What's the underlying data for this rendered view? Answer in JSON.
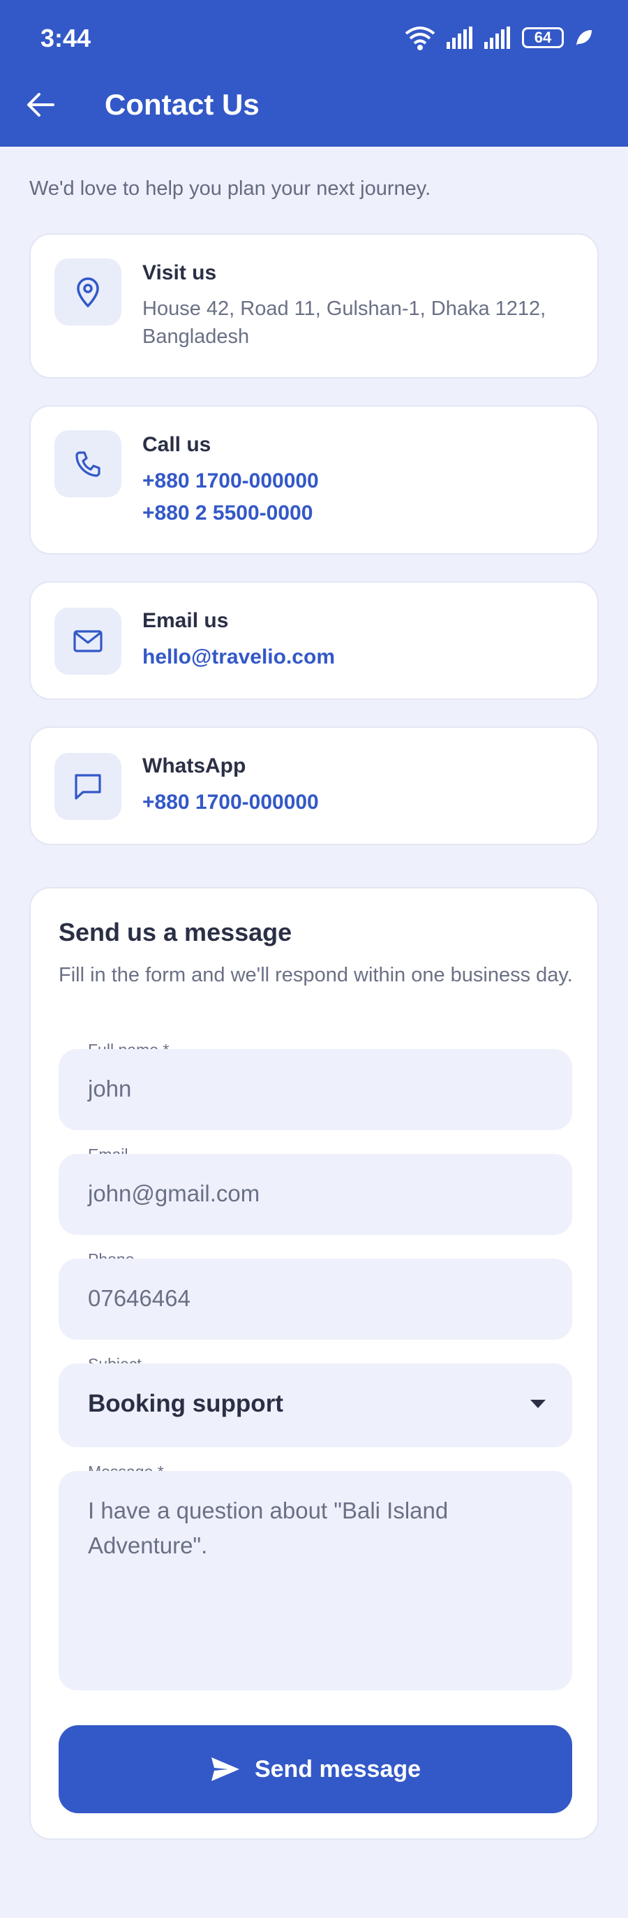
{
  "status_bar": {
    "time": "3:44",
    "battery": "64"
  },
  "app_bar": {
    "title": "Contact Us"
  },
  "intro": "We'd love to help you plan your next journey.",
  "cards": {
    "visit": {
      "title": "Visit us",
      "address": "House 42, Road 11, Gulshan-1, Dhaka 1212, Bangladesh",
      "icon": "location-pin-icon"
    },
    "call": {
      "title": "Call us",
      "phone1": "+880 1700-000000",
      "phone2": "+880 2 5500-0000",
      "icon": "phone-icon"
    },
    "email": {
      "title": "Email us",
      "address": "hello@travelio.com",
      "icon": "mail-icon"
    },
    "whatsapp": {
      "title": "WhatsApp",
      "phone": "+880 1700-000000",
      "icon": "chat-icon"
    }
  },
  "form": {
    "title": "Send us a message",
    "subtitle": "Fill in the form and we'll respond within one business day.",
    "full_name": {
      "label": "Full name *",
      "value": "john"
    },
    "email": {
      "label": "Email",
      "value": "john@gmail.com"
    },
    "phone": {
      "label": "Phone",
      "value": "07646464"
    },
    "subject": {
      "label": "Subject",
      "value": "Booking support"
    },
    "message": {
      "label": "Message *",
      "value": "I have a question about \"Bali Island Adventure\"."
    },
    "submit_label": "Send message"
  },
  "colors": {
    "primary": "#3358C7",
    "background": "#EEF0FB",
    "card": "#FFFFFF"
  }
}
